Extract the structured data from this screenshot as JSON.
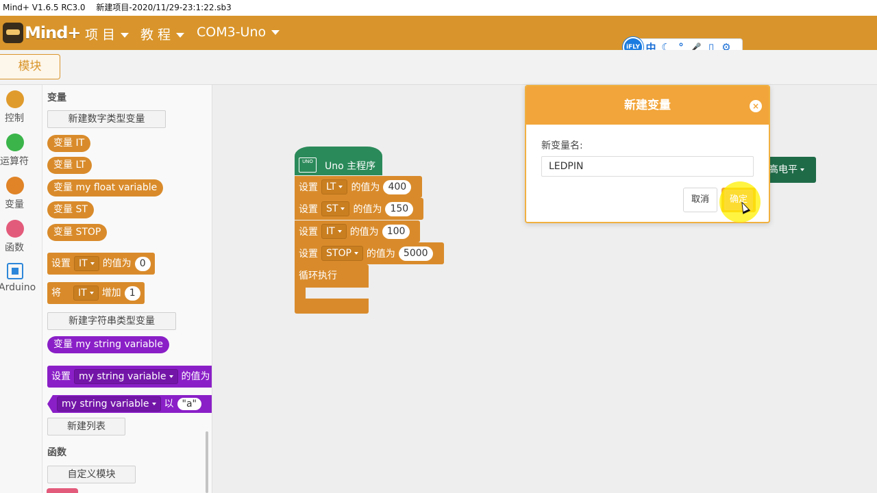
{
  "window": {
    "app": "Mind+ V1.6.5 RC3.0",
    "file": "新建项目-2020/11/29-23:1:22.sb3"
  },
  "menubar": {
    "logo": "Mind+",
    "items": [
      "项 目",
      "教 程",
      "COM3-Uno"
    ]
  },
  "ifly": {
    "logo": "iFLY",
    "icons": [
      "中",
      "moon-icon",
      "punctuation-icon",
      "microphone-icon",
      "keyboard-icon",
      "gear-icon"
    ],
    "glyphs": [
      "中",
      "☾",
      "°",
      "🎤",
      "▯",
      "⚙"
    ]
  },
  "tabs": {
    "blocks": "模块"
  },
  "categories": [
    {
      "label": "控制",
      "color": "#e09b2d"
    },
    {
      "label": "运算符",
      "color": "#3bb54a"
    },
    {
      "label": "变量",
      "color": "#e08427"
    },
    {
      "label": "函数",
      "color": "#e35b7b"
    },
    {
      "label": "Arduino",
      "color": "#2d86d9"
    }
  ],
  "palette": {
    "variables_title": "变量",
    "new_number_var": "新建数字类型变量",
    "number_vars": [
      "变量 IT",
      "变量 LT",
      "变量 my float variable",
      "变量 ST",
      "变量 STOP"
    ],
    "set_block": {
      "prefix": "设置",
      "var": "IT",
      "mid": "的值为",
      "value": "0"
    },
    "change_block": {
      "prefix": "将",
      "var": "IT",
      "mid": "增加",
      "value": "1"
    },
    "new_string_var": "新建字符串类型变量",
    "string_var": "变量 my string variable",
    "set_string_block": {
      "prefix": "设置",
      "var": "my string variable",
      "mid": "的值为"
    },
    "string_reporter": {
      "var": "my string variable",
      "mid": "以",
      "value": "\"a\""
    },
    "new_list": "新建列表",
    "functions_title": "函数",
    "custom_block": "自定义模块"
  },
  "workspace": {
    "hat": {
      "board": "UNO",
      "label": "Uno 主程序"
    },
    "set_blocks": [
      {
        "prefix": "设置",
        "var": "LT",
        "mid": "的值为",
        "value": "400"
      },
      {
        "prefix": "设置",
        "var": "ST",
        "mid": "的值为",
        "value": "150"
      },
      {
        "prefix": "设置",
        "var": "IT",
        "mid": "的值为",
        "value": "100"
      },
      {
        "prefix": "设置",
        "var": "STOP",
        "mid": "的值为",
        "value": "5000"
      }
    ],
    "loop": "循环执行",
    "partial_block": "高电平"
  },
  "modal": {
    "title": "新建变量",
    "close": "×",
    "label": "新变量名:",
    "input_value": "LEDPIN",
    "cancel": "取消",
    "ok": "确定"
  }
}
